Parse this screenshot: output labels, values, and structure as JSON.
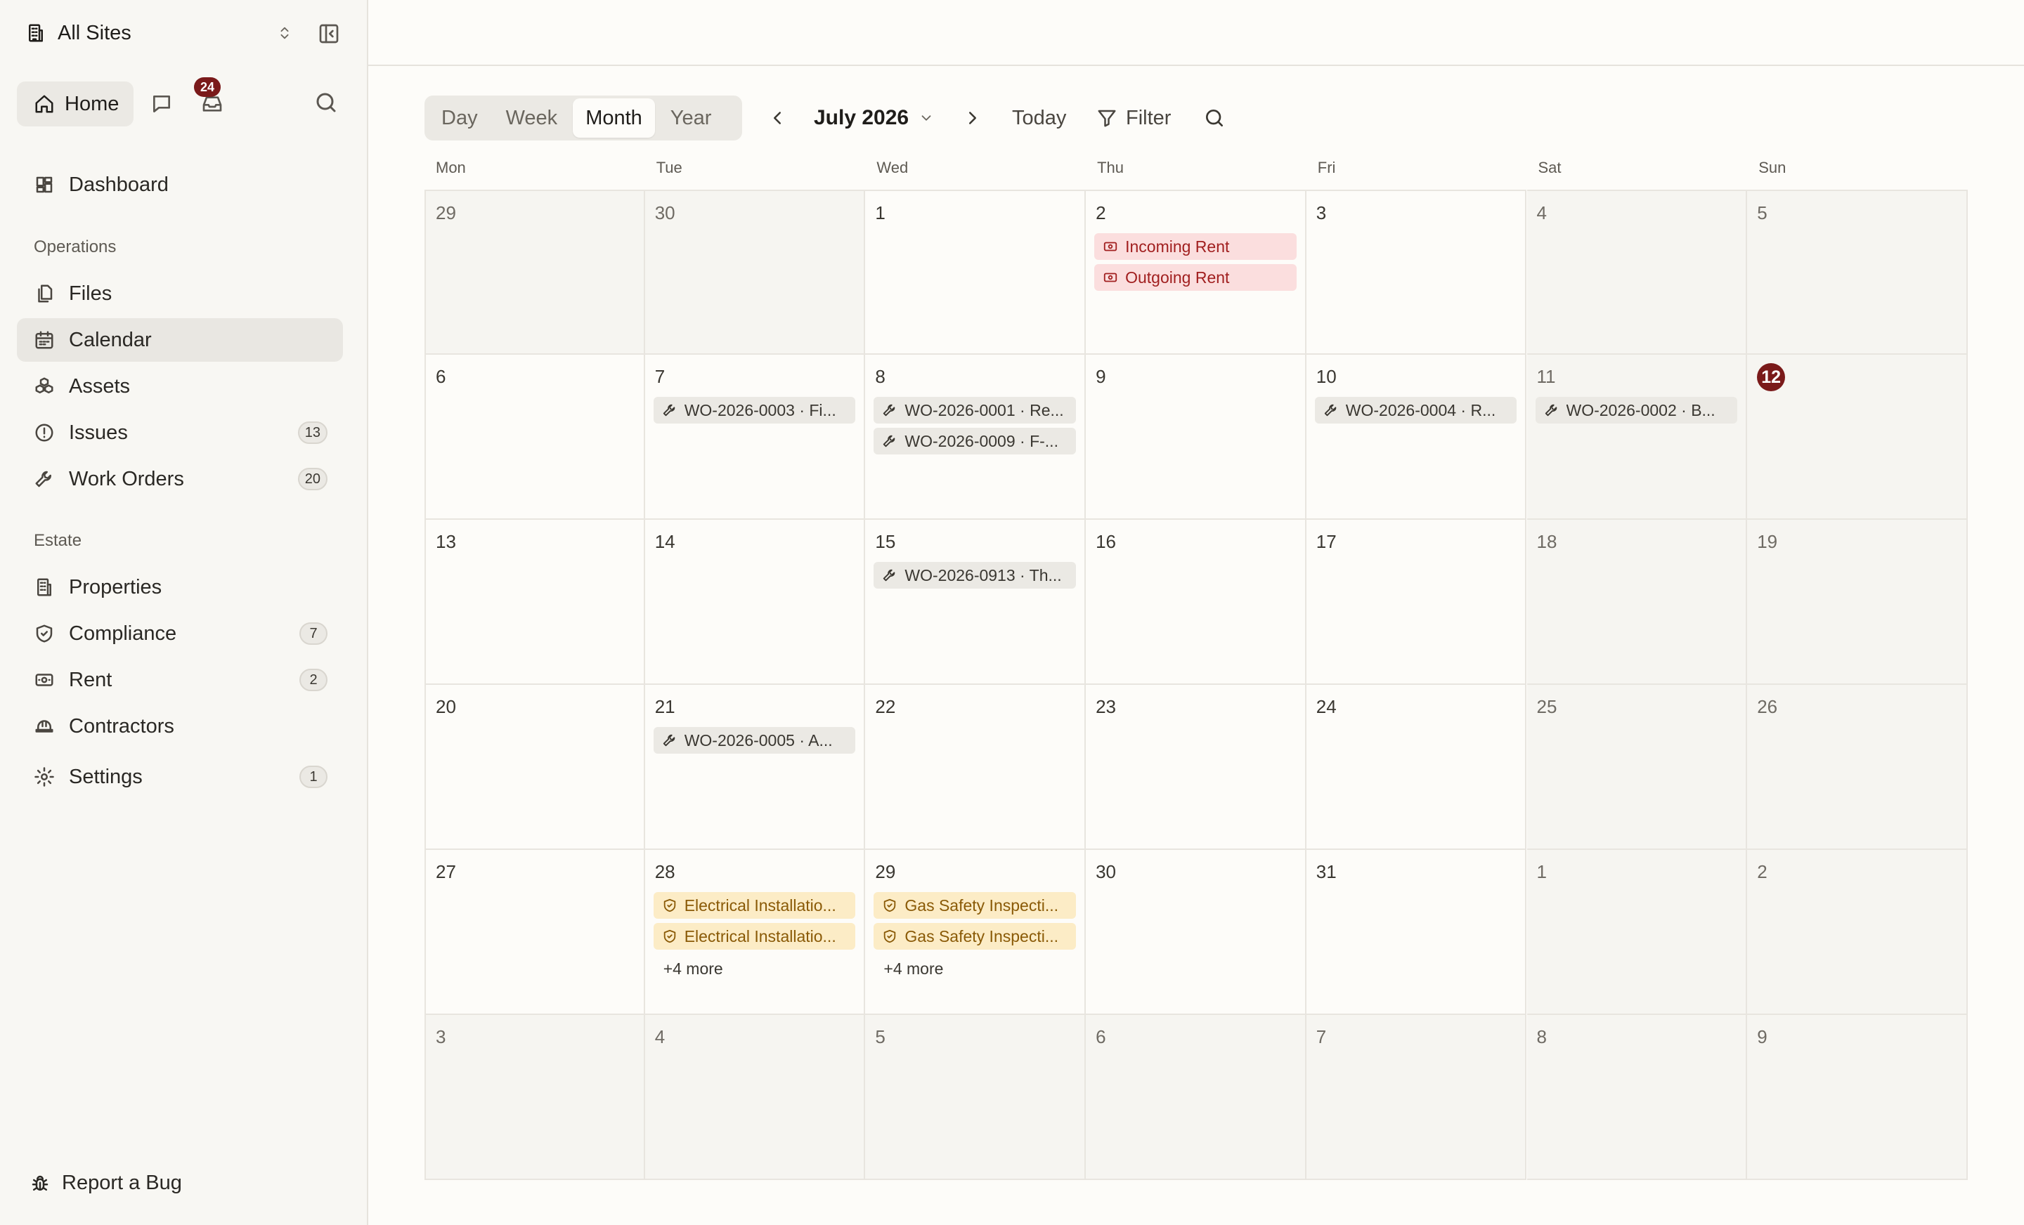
{
  "sidebar": {
    "site": "All Sites",
    "home": "Home",
    "inbox_count": "24",
    "dashboard": "Dashboard",
    "sections": {
      "operations": "Operations",
      "estate": "Estate"
    },
    "items": {
      "files": "Files",
      "calendar": "Calendar",
      "assets": "Assets",
      "issues": {
        "label": "Issues",
        "count": "13"
      },
      "work_orders": {
        "label": "Work Orders",
        "count": "20"
      },
      "properties": "Properties",
      "compliance": {
        "label": "Compliance",
        "count": "7"
      },
      "rent": {
        "label": "Rent",
        "count": "2"
      },
      "contractors": "Contractors",
      "settings": {
        "label": "Settings",
        "count": "1"
      }
    },
    "report_bug": "Report a Bug"
  },
  "toolbar": {
    "views": [
      "Day",
      "Week",
      "Month",
      "Year"
    ],
    "selected_view": "Month",
    "month": "July 2026",
    "today": "Today",
    "filter": "Filter"
  },
  "calendar": {
    "weekdays": [
      "Mon",
      "Tue",
      "Wed",
      "Thu",
      "Fri",
      "Sat",
      "Sun"
    ],
    "today": "12",
    "weeks": [
      [
        {
          "d": "29",
          "out": true
        },
        {
          "d": "30",
          "out": true
        },
        {
          "d": "1"
        },
        {
          "d": "2",
          "events": [
            {
              "kind": "rent",
              "text": "Incoming Rent"
            },
            {
              "kind": "rent",
              "text": "Outgoing Rent"
            }
          ]
        },
        {
          "d": "3"
        },
        {
          "d": "4",
          "weekend": true
        },
        {
          "d": "5",
          "weekend": true
        }
      ],
      [
        {
          "d": "6"
        },
        {
          "d": "7",
          "events": [
            {
              "kind": "wo",
              "text": "WO-2026-0003 · Fi..."
            }
          ]
        },
        {
          "d": "8",
          "events": [
            {
              "kind": "wo",
              "text": "WO-2026-0001 · Re..."
            },
            {
              "kind": "wo",
              "text": "WO-2026-0009 · F-..."
            }
          ]
        },
        {
          "d": "9"
        },
        {
          "d": "10",
          "events": [
            {
              "kind": "wo",
              "text": "WO-2026-0004 · R..."
            }
          ]
        },
        {
          "d": "11",
          "weekend": true,
          "events": [
            {
              "kind": "wo",
              "text": "WO-2026-0002 · B..."
            }
          ]
        },
        {
          "d": "12",
          "weekend": true,
          "today": true
        }
      ],
      [
        {
          "d": "13"
        },
        {
          "d": "14"
        },
        {
          "d": "15",
          "events": [
            {
              "kind": "wo",
              "text": "WO-2026-0913 · Th..."
            }
          ]
        },
        {
          "d": "16"
        },
        {
          "d": "17"
        },
        {
          "d": "18",
          "weekend": true
        },
        {
          "d": "19",
          "weekend": true
        }
      ],
      [
        {
          "d": "20"
        },
        {
          "d": "21",
          "events": [
            {
              "kind": "wo",
              "text": "WO-2026-0005 · A..."
            }
          ]
        },
        {
          "d": "22"
        },
        {
          "d": "23"
        },
        {
          "d": "24"
        },
        {
          "d": "25",
          "weekend": true
        },
        {
          "d": "26",
          "weekend": true
        }
      ],
      [
        {
          "d": "27"
        },
        {
          "d": "28",
          "events": [
            {
              "kind": "comp",
              "text": "Electrical Installatio..."
            },
            {
              "kind": "comp",
              "text": "Electrical Installatio..."
            }
          ],
          "more": "+4 more"
        },
        {
          "d": "29",
          "events": [
            {
              "kind": "comp",
              "text": "Gas Safety Inspecti..."
            },
            {
              "kind": "comp",
              "text": "Gas Safety Inspecti..."
            }
          ],
          "more": "+4 more"
        },
        {
          "d": "30"
        },
        {
          "d": "31"
        },
        {
          "d": "1",
          "out": true
        },
        {
          "d": "2",
          "out": true
        }
      ],
      [
        {
          "d": "3",
          "out": true
        },
        {
          "d": "4",
          "out": true
        },
        {
          "d": "5",
          "out": true
        },
        {
          "d": "6",
          "out": true
        },
        {
          "d": "7",
          "out": true
        },
        {
          "d": "8",
          "out": true
        },
        {
          "d": "9",
          "out": true
        }
      ]
    ]
  },
  "colors": {
    "accent": "#7a1a1a",
    "rent_bg": "#fbdede",
    "rent_fg": "#a11f1f",
    "compliance_bg": "#fcecc6",
    "compliance_fg": "#8a5a07",
    "work_order_bg": "#ebe9e4"
  },
  "icons": {
    "work_order": "wrench-icon",
    "rent": "banknote-icon",
    "compliance": "shield-check-icon"
  }
}
